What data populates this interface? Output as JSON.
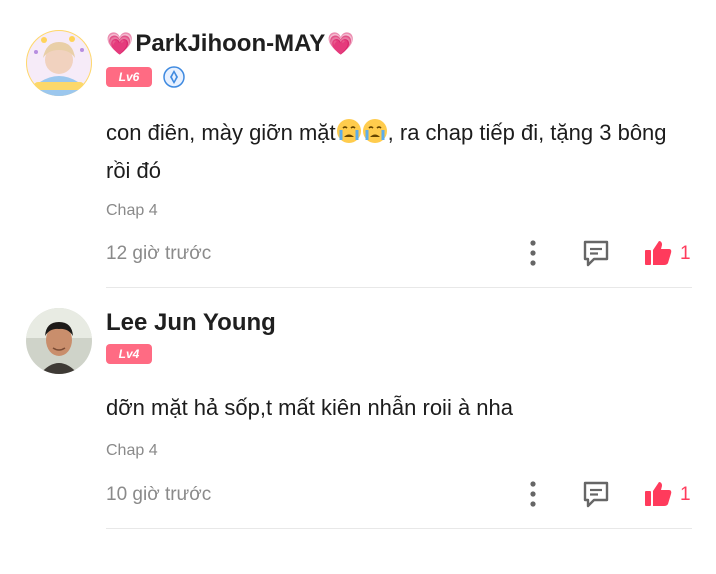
{
  "comments": [
    {
      "username": "ParkJihoon-MAY",
      "level": "Lv6",
      "text_before_emoji": "con điên, mày giỡn mặt",
      "text_after_emoji": ", ra chap tiếp đi, tặng 3 bông rồi đó",
      "chapter": "Chap 4",
      "time": "12 giờ trước",
      "likes": "1"
    },
    {
      "username": "Lee Jun Young",
      "level": "Lv4",
      "text": "dỡn mặt hả sốp,t mất kiên nhẫn roii à nha",
      "chapter": "Chap 4",
      "time": "10 giờ trước",
      "likes": "1"
    }
  ],
  "colors": {
    "like": "#ff3b5c",
    "level_badge": "#ff6b83",
    "heart": "#ff3d9a",
    "muted_text": "#8a8a8a"
  },
  "icons": [
    "heart-icon",
    "level-badge",
    "verified-icon",
    "crying-emoji-icon",
    "more-icon",
    "reply-icon",
    "like-icon"
  ]
}
